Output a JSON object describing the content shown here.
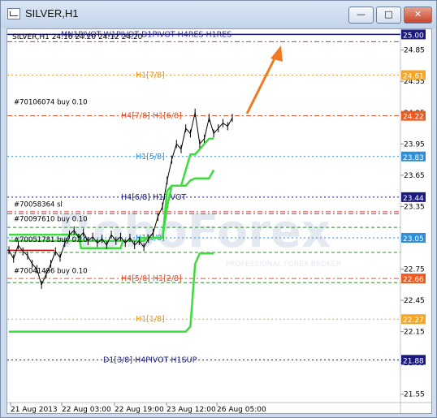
{
  "window": {
    "title": "SILVER,H1",
    "buttons": {
      "minimize": "—",
      "maximize": "□",
      "close": "✕"
    }
  },
  "chart_data": {
    "type": "line",
    "header": "SILVER,H1  24.16 24.20 24.12 24.20",
    "y_ticks": [
      "24.85",
      "24.55",
      "24.25",
      "23.95",
      "23.65",
      "23.35",
      "23.05",
      "22.75",
      "22.45",
      "22.15",
      "21.85",
      "21.55"
    ],
    "x_ticks": [
      "21 Aug 2013",
      "22 Aug 03:00",
      "22 Aug 19:00",
      "23 Aug 12:00",
      "26 Aug 05:00"
    ],
    "ylim": [
      21.47,
      25.05
    ],
    "levels": [
      {
        "value": 25.0,
        "label": "MN1PIVOT W1PIVOT D1PIVOT H4RES H1RES",
        "price": "25.00",
        "color": "#1a1a80",
        "text_color": "#2b2b8a",
        "dash": "solid",
        "badge": "#1a1a80"
      },
      {
        "value": 24.61,
        "label": "H1[7/8]",
        "price": "24.61",
        "color": "#f0a030",
        "text_color": "#e8900a",
        "dash": "2,3",
        "badge": "#f5a623"
      },
      {
        "value": 24.22,
        "label": "H4[7/8] H1[6/8]",
        "price": "24.22",
        "color": "#e0502a",
        "text_color": "#e0502a",
        "dash": "6,3,2,3",
        "badge": "#ef5a1f"
      },
      {
        "value": 23.83,
        "label": "H1[5/8]",
        "price": "23.83",
        "color": "#2b8fd9",
        "text_color": "#2b8fd9",
        "dash": "2,3",
        "badge": "#2b8fd9"
      },
      {
        "value": 23.44,
        "label": "H4[6/8] H1PIVOT",
        "price": "23.44",
        "color": "#1a1a80",
        "text_color": "#1a1a80",
        "dash": "2,3",
        "badge": "#1a1a80"
      },
      {
        "value": 23.05,
        "label": "H1[3/8]",
        "price": "23.05",
        "color": "#2b8fd9",
        "text_color": "#2b8fd9",
        "dash": "2,3",
        "badge": "#2b8fd9"
      },
      {
        "value": 22.66,
        "label": "H4[5/8] H1[2/8]",
        "price": "22.66",
        "color": "#e0502a",
        "text_color": "#e0502a",
        "dash": "6,3,2,3",
        "badge": "#ef5a1f"
      },
      {
        "value": 22.27,
        "label": "H1[1/8]",
        "price": "22.27",
        "color": "#f0a030",
        "text_color": "#e8900a",
        "dash": "2,3",
        "badge": "#f5a623"
      },
      {
        "value": 21.88,
        "label": "D1[3/8] H4PIVOT H1SUP",
        "price": "21.88",
        "color": "#1a1a80",
        "text_color": "#1a1a80",
        "dash": "2,3",
        "badge": "#1a1a80"
      }
    ],
    "extra_lines": [
      {
        "value": 24.93,
        "color": "#e0302a",
        "dash": "6,3,2,3"
      },
      {
        "value": 23.3,
        "color": "#e0302a",
        "dash": "6,3,2,3"
      },
      {
        "value": 23.28,
        "color": "#e0302a",
        "dash": "6,3,2,3"
      },
      {
        "value": 23.15,
        "color": "#2e8b2e",
        "dash": "4,3"
      },
      {
        "value": 22.91,
        "color": "#2e8b2e",
        "dash": "4,3"
      },
      {
        "value": 22.62,
        "color": "#2e8b2e",
        "dash": "4,3"
      }
    ],
    "orders": [
      {
        "label": "#70106074 buy 0.10",
        "value": 24.3
      },
      {
        "label": "#70058364 sl",
        "value": 23.32
      },
      {
        "label": "#70097610 buy 0.10",
        "value": 23.18
      },
      {
        "label": "#70051781 buy 0.10",
        "value": 22.98
      },
      {
        "label": "#70041496 buy 0.10",
        "value": 22.68
      }
    ],
    "red_segment": {
      "value": 22.93,
      "color": "#cc0000"
    },
    "watermark": "RoboForex",
    "watermark_sub": "PROFESSIONAL FOREX BROKER",
    "current_price": "24.20",
    "price": {
      "x": [
        0,
        2,
        4,
        6,
        8,
        10,
        12,
        14,
        16,
        18,
        20,
        22,
        24,
        26,
        28,
        30,
        32,
        34,
        36,
        38,
        40,
        42,
        44,
        46,
        48,
        50,
        52,
        54,
        56,
        58,
        60,
        62,
        64,
        66,
        68,
        70,
        72,
        74,
        76,
        78,
        80,
        82,
        84,
        86,
        88,
        90,
        92,
        94,
        96
      ],
      "y": [
        22.93,
        22.85,
        22.98,
        22.92,
        22.88,
        22.8,
        22.75,
        22.6,
        22.7,
        22.8,
        22.92,
        22.86,
        23.0,
        23.08,
        23.12,
        23.05,
        23.1,
        23.02,
        23.06,
        23.0,
        23.04,
        22.98,
        23.08,
        23.02,
        23.06,
        23.0,
        23.05,
        22.98,
        23.02,
        22.96,
        23.04,
        23.1,
        23.25,
        23.35,
        23.6,
        23.8,
        23.95,
        23.9,
        24.1,
        24.05,
        24.25,
        23.95,
        24.0,
        24.2,
        24.05,
        24.1,
        24.15,
        24.12,
        24.2
      ],
      "color": "#000000"
    },
    "trailing_lines": [
      {
        "name": "",
        "x": [
          0,
          2,
          30,
          31,
          48,
          49,
          56,
          57,
          58,
          60,
          62,
          64,
          66,
          68,
          70,
          72,
          74,
          76,
          78,
          80,
          82,
          84,
          86,
          88
        ],
        "y": [
          23.08,
          23.08,
          23.08,
          22.95,
          22.95,
          23.02,
          23.02,
          23.05,
          23.05,
          23.05,
          23.05,
          23.05,
          23.05,
          23.35,
          23.55,
          23.55,
          23.55,
          23.7,
          23.85,
          23.85,
          23.9,
          23.95,
          24.0,
          24.0
        ],
        "color": "#3ddc3d"
      },
      {
        "name": "",
        "x": [
          0,
          2,
          30,
          58,
          60,
          62,
          64,
          66,
          68,
          70,
          72,
          74,
          76,
          78,
          80,
          82,
          84,
          86,
          88
        ],
        "y": [
          23.02,
          23.02,
          23.02,
          23.02,
          23.05,
          23.05,
          23.05,
          23.05,
          23.5,
          23.55,
          23.55,
          23.55,
          23.55,
          23.6,
          23.62,
          23.62,
          23.62,
          23.62,
          23.7
        ],
        "color": "#3ddc3d"
      },
      {
        "name": "",
        "x": [
          0,
          48,
          62,
          64,
          66,
          68,
          70,
          72,
          74,
          76,
          78,
          80,
          82,
          84,
          86,
          88
        ],
        "y": [
          22.15,
          22.15,
          22.15,
          22.15,
          22.15,
          22.15,
          22.15,
          22.15,
          22.15,
          22.15,
          22.2,
          22.8,
          22.9,
          22.9,
          22.9,
          22.9
        ],
        "color": "#3ddc3d"
      }
    ],
    "xlim": [
      0,
      96
    ]
  }
}
